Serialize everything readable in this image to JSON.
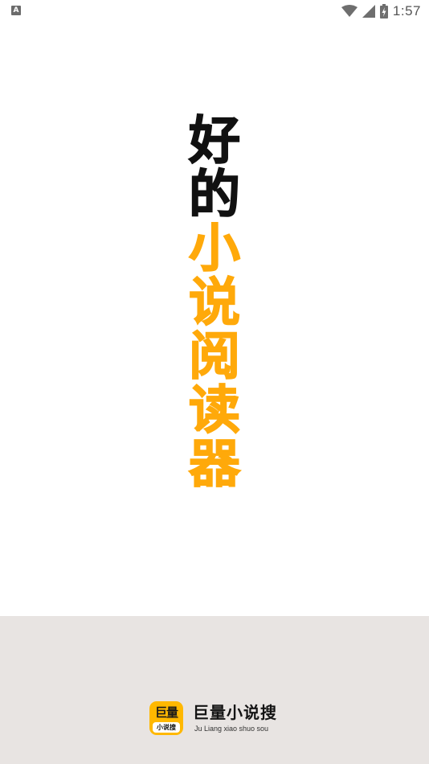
{
  "status_bar": {
    "notification_icon": "A",
    "time": "1:57",
    "icons": [
      "wifi-icon",
      "cell-signal-icon",
      "battery-charging-icon"
    ]
  },
  "splash": {
    "title_chars": [
      {
        "char": "好",
        "color": "#111111"
      },
      {
        "char": "的",
        "color": "#111111"
      },
      {
        "char": "小",
        "color": "#ffa90a"
      },
      {
        "char": "说",
        "color": "#ffa90a"
      },
      {
        "char": "阅",
        "color": "#ffa90a"
      },
      {
        "char": "读",
        "color": "#ffa90a"
      },
      {
        "char": "器",
        "color": "#ffa90a"
      }
    ]
  },
  "footer": {
    "app_icon_top": "巨量",
    "app_icon_bottom": "小说搜",
    "brand_name": "巨量小说搜",
    "brand_subtitle": "Ju Liang xiao shuo sou"
  },
  "colors": {
    "accent": "#ffa90a",
    "footer_bg": "#e8e4e2",
    "icon_bg": "#ffb800"
  }
}
